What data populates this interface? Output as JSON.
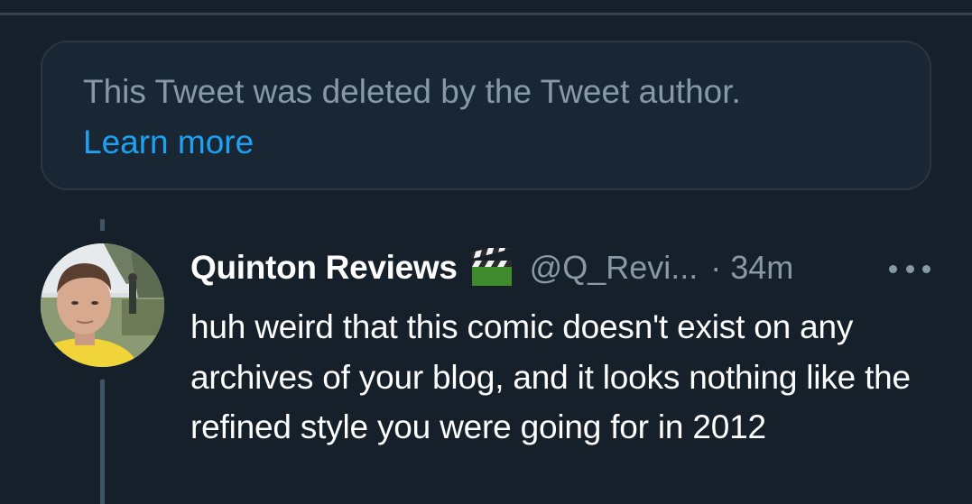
{
  "deleted_notice": {
    "text": "This Tweet was deleted by the Tweet author.",
    "link_label": "Learn more"
  },
  "tweet": {
    "author_name": "Quinton Reviews",
    "author_icon": "clapper-board-icon",
    "handle": "@Q_Revi...",
    "separator": "·",
    "time": "34m",
    "more_icon": "more-horizontal-icon",
    "body": "huh weird that this comic doesn't exist on any archives of your blog, and it looks nothing like the refined style you were going for in 2012"
  },
  "colors": {
    "background": "#15202b",
    "card": "#192734",
    "muted_text": "#8899a6",
    "link": "#1da1f2",
    "primary_text": "#ffffff"
  }
}
